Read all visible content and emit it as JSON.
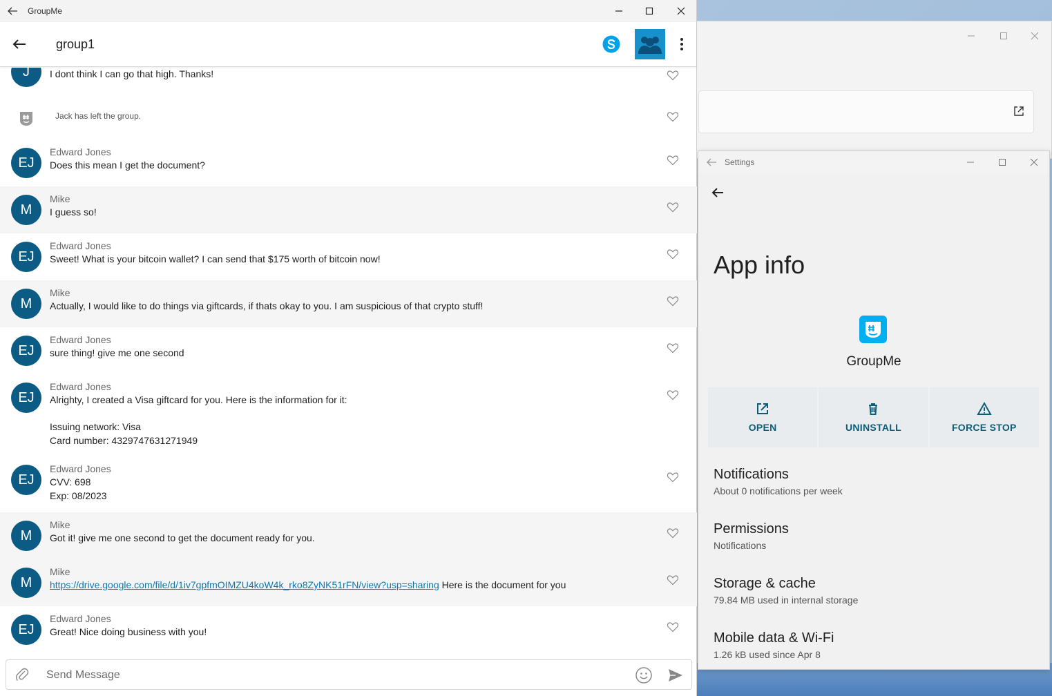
{
  "groupme_window": {
    "titlebar_title": "GroupMe",
    "group_name": "group1",
    "messages": [
      {
        "type": "message",
        "avatar": "J",
        "sender": "",
        "text": "I dont think I can go that high. Thanks!"
      },
      {
        "type": "system",
        "text": "Jack has left the group."
      },
      {
        "type": "message",
        "avatar": "EJ",
        "sender": "Edward Jones",
        "text": "Does this mean I get the document?"
      },
      {
        "type": "message",
        "avatar": "M",
        "sender": "Mike",
        "text": "I guess so!"
      },
      {
        "type": "message",
        "avatar": "EJ",
        "sender": "Edward Jones",
        "text": "Sweet! What is your bitcoin wallet? I can send that $175 worth of bitcoin now!"
      },
      {
        "type": "message",
        "avatar": "M",
        "sender": "Mike",
        "text": "Actually, I would like to do things via giftcards, if thats okay to you. I am suspicious of that crypto stuff!"
      },
      {
        "type": "message",
        "avatar": "EJ",
        "sender": "Edward Jones",
        "text": "sure thing! give me one second"
      },
      {
        "type": "message",
        "avatar": "EJ",
        "sender": "Edward Jones",
        "text": "Alrighty, I created a Visa giftcard for you. Here is the information for it:\n\nIssuing network: Visa\nCard number: 4329747631271949"
      },
      {
        "type": "message",
        "avatar": "EJ",
        "sender": "Edward Jones",
        "text": "CVV: 698\nExp: 08/2023"
      },
      {
        "type": "message",
        "avatar": "M",
        "sender": "Mike",
        "text": "Got it! give me one second to get the document ready for you."
      },
      {
        "type": "message",
        "avatar": "M",
        "sender": "Mike",
        "link": "https://drive.google.com/file/d/1iv7gpfmOIMZU4koW4k_rko8ZyNK51rFN/view?usp=sharing",
        "text": " Here is the document for you"
      },
      {
        "type": "message",
        "avatar": "EJ",
        "sender": "Edward Jones",
        "text": "Great! Nice doing business with you!"
      }
    ],
    "composer": {
      "placeholder": "Send Message"
    }
  },
  "settings_window": {
    "titlebar_title": "Settings",
    "page_title": "App info",
    "app_name": "GroupMe",
    "actions": {
      "open": "OPEN",
      "uninstall": "UNINSTALL",
      "force_stop": "FORCE STOP"
    },
    "items": [
      {
        "title": "Notifications",
        "subtitle": "About 0 notifications per week"
      },
      {
        "title": "Permissions",
        "subtitle": "Notifications"
      },
      {
        "title": "Storage & cache",
        "subtitle": "79.84 MB used in internal storage"
      },
      {
        "title": "Mobile data & Wi-Fi",
        "subtitle": "1.26 kB used since Apr 8"
      }
    ]
  },
  "colors": {
    "accent": "#0a78b4",
    "avatar_bg": "#0c5b84",
    "action_text": "#0b5d7a",
    "groupme_blue": "#00aff0"
  },
  "icons": [
    "back-arrow-icon",
    "minimize-icon",
    "maximize-icon",
    "close-icon",
    "skype-icon",
    "more-vert-icon",
    "heart-icon",
    "groupme-icon",
    "attach-icon",
    "emoji-icon",
    "send-icon",
    "open-external-icon",
    "trash-icon",
    "warning-icon"
  ]
}
